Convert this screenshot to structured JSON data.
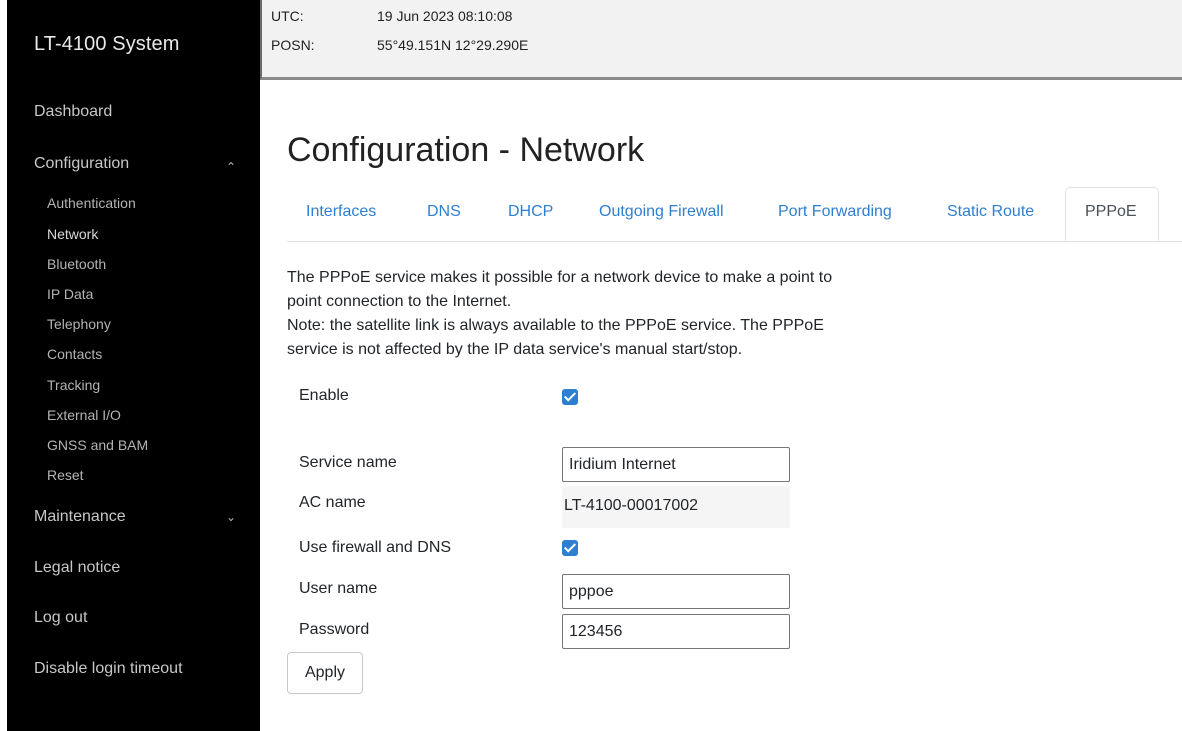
{
  "sidebar": {
    "brand": "LT-4100 System",
    "dashboard": "Dashboard",
    "configuration": "Configuration",
    "configuration_items": [
      "Authentication",
      "Network",
      "Bluetooth",
      "IP Data",
      "Telephony",
      "Contacts",
      "Tracking",
      "External I/O",
      "GNSS and BAM",
      "Reset"
    ],
    "maintenance": "Maintenance",
    "legal_notice": "Legal notice",
    "log_out": "Log out",
    "disable_login_timeout": "Disable login timeout",
    "chevron_up": "^",
    "chevron_down": "v"
  },
  "status": {
    "utc_label": "UTC:",
    "utc_value": "19 Jun 2023 08:10:08",
    "posn_label": "POSN:",
    "posn_value": "55°49.151N 12°29.290E"
  },
  "main": {
    "title": "Configuration - Network",
    "tabs": [
      "Interfaces",
      "DNS",
      "DHCP",
      "Outgoing Firewall",
      "Port Forwarding",
      "Static Route"
    ],
    "active_tab": "PPPoE",
    "description": [
      "The PPPoE service makes it possible for a network device to make a point to",
      "point connection to the Internet.",
      "Note: the satellite link is always available to the PPPoE service. The PPPoE",
      "service is not affected by the IP data service's manual start/stop."
    ],
    "form": {
      "enable_label": "Enable",
      "enable_checked": true,
      "service_name_label": "Service name",
      "service_name_value": "Iridium Internet",
      "ac_name_label": "AC name",
      "ac_name_value": "LT-4100-00017002",
      "use_firewall_label": "Use firewall and DNS",
      "use_firewall_checked": true,
      "user_name_label": "User name",
      "user_name_value": "pppoe",
      "password_label": "Password",
      "password_value": "123456"
    },
    "apply_label": "Apply"
  },
  "colors": {
    "accent": "#2f7fcf",
    "sidebar_bg": "#000000",
    "statusbar_bg": "#f2f2f2"
  }
}
